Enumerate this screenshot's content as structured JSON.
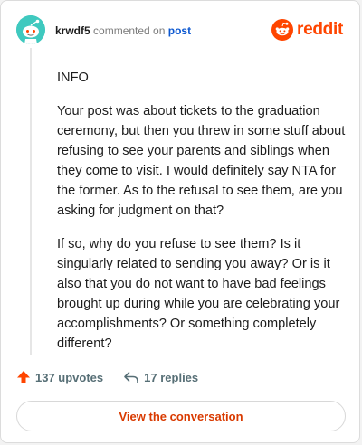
{
  "header": {
    "username": "krwdf5",
    "action_text": "commented on",
    "post_link": "post"
  },
  "brand": {
    "wordmark": "reddit",
    "color": "#ff4500"
  },
  "comment": {
    "paragraphs": [
      "INFO",
      "Your post was about tickets to the graduation ceremony, but then you threw in some stuff about refusing to see your parents and siblings when they come to visit. I would definitely say NTA for the former. As to the refusal to see them, are you asking for judgment on that?",
      "If so, why do you refuse to see them? Is it singularly related to sending you away? Or is it also that you do not want to have bad feelings brought up during while you are celebrating your accomplishments? Or something completely different?"
    ]
  },
  "actions": {
    "upvotes": "137 upvotes",
    "replies": "17 replies",
    "upvote_icon": "upvote-arrow-icon",
    "reply_icon": "reply-arrow-icon"
  },
  "footer": {
    "view_label": "View the conversation"
  },
  "colors": {
    "avatar": "#3fc9bf",
    "upvote": "#ff4500",
    "link": "#0b57d0",
    "button_text": "#d93a00"
  }
}
